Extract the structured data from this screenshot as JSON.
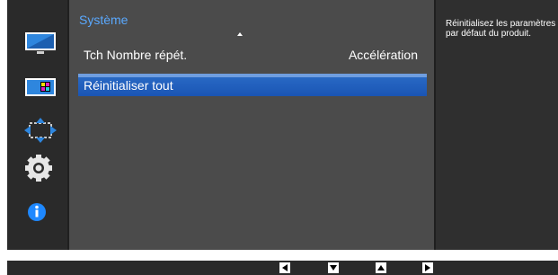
{
  "menu": {
    "title": "Système",
    "items": [
      {
        "label": "Tch Nombre répét.",
        "value": "Accélération",
        "selected": false
      },
      {
        "label": "Réinitialiser tout",
        "value": "",
        "selected": true
      }
    ]
  },
  "help": {
    "text": "Réinitialisez les paramètres par défaut du produit."
  },
  "sidebar": {
    "icons": [
      "picture-icon",
      "color-icon",
      "size-position-icon",
      "system-gear-icon",
      "information-icon"
    ]
  },
  "nav": {
    "buttons": [
      "left-arrow-icon",
      "down-arrow-icon",
      "up-arrow-icon",
      "right-arrow-icon"
    ]
  },
  "colors": {
    "title": "#5aa9ff",
    "selection": "#1a55b4",
    "panel": "#4b4b4b",
    "background": "#1f1f1f"
  }
}
